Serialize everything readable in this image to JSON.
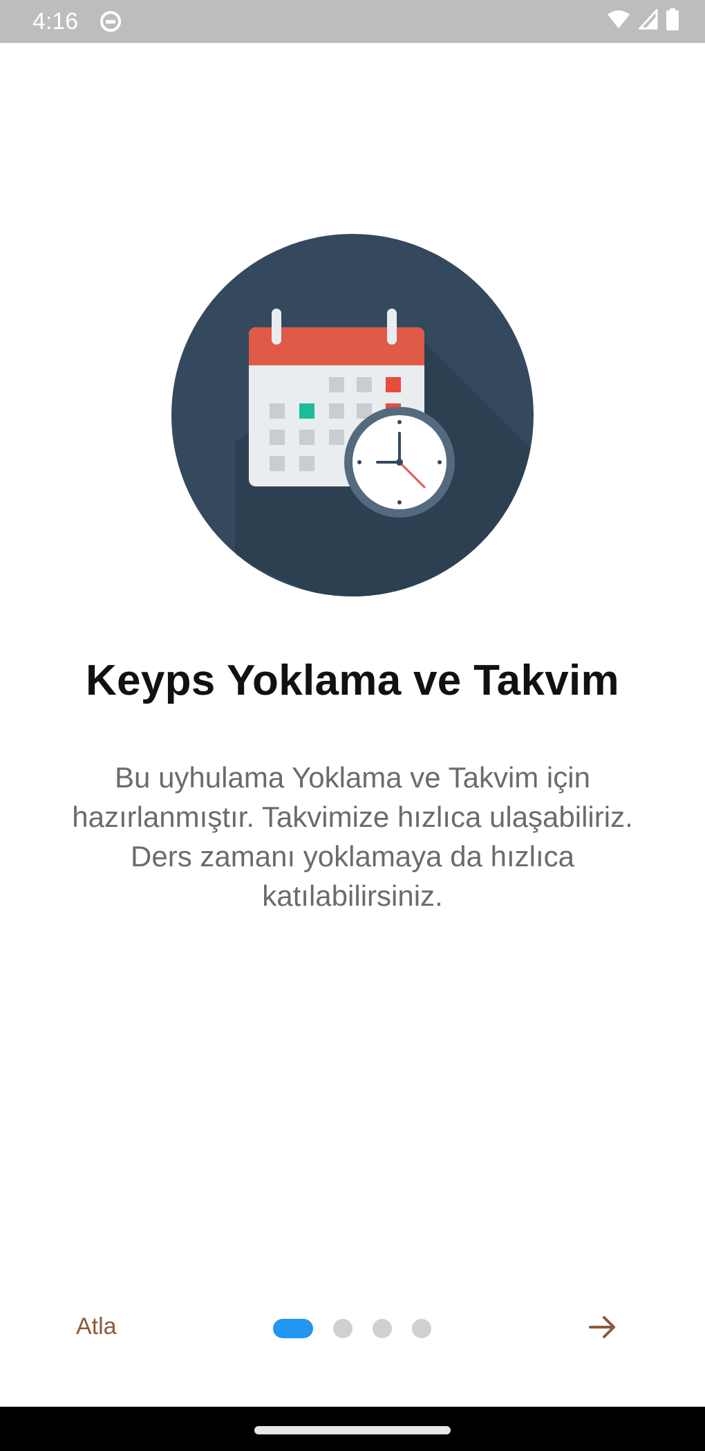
{
  "status_bar": {
    "time": "4:16",
    "icons": [
      "app-notification-icon",
      "wifi-icon",
      "signal-icon",
      "battery-icon"
    ]
  },
  "onboarding": {
    "title": "Keyps Yoklama ve Takvim",
    "description": "Bu uyhulama Yoklama ve Takvim için hazırlanmıştır. Takvimize hızlıca ulaşabiliriz. Ders zamanı yoklamaya da hızlıca katılabilirsiniz.",
    "illustration_icon": "calendar-clock-icon"
  },
  "footer": {
    "skip_label": "Atla",
    "page_count": 4,
    "active_page": 1,
    "next_icon": "arrow-right-icon"
  },
  "colors": {
    "accent": "#2196f3",
    "circle": "#34495e",
    "calendar_header": "#e05a48",
    "skip_text": "#8a5a3c"
  }
}
